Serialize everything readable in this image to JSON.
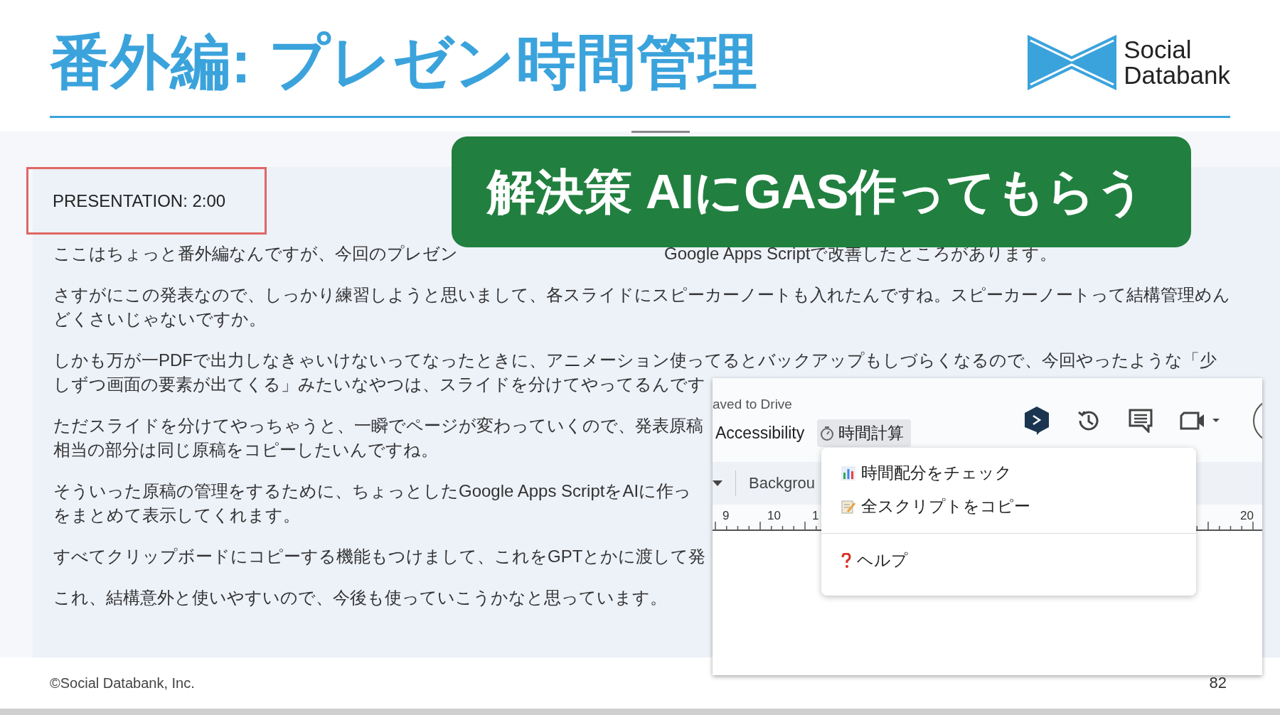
{
  "slide": {
    "title": "番外編: プレゼン時間管理",
    "logo_lines": [
      "Social",
      "Databank"
    ],
    "copyright": "©Social Databank, Inc.",
    "page_number": "82"
  },
  "notes": {
    "heading": "PRESENTATION: 2:00",
    "paragraphs": [
      {
        "lines": [
          [
            "ここはちょっと番外編なんですが、今回のプレゼン",
            "Google Apps Scriptで改善したところがあります。"
          ]
        ]
      },
      {
        "lines": [
          [
            "さすがにこの発表なので、しっかり練習しようと思いまして、各スライドにスピーカーノートも入れたんですね。スピーカーノートって結構管理めん"
          ],
          [
            "どくさいじゃないですか。"
          ]
        ]
      },
      {
        "lines": [
          [
            "しかも万が一PDFで出力しなきゃいけないってなったときに、アニメーション使ってるとバックアップもしづらくなるので、今回やったような「少"
          ],
          [
            "しずつ画面の要素が出てくる」みたいなやつは、スライドを分けてやってるんです"
          ]
        ]
      },
      {
        "lines": [
          [
            "ただスライドを分けてやっちゃうと、一瞬でページが変わっていくので、発表原稿"
          ],
          [
            "相当の部分は同じ原稿をコピーしたいんですね。"
          ]
        ]
      },
      {
        "lines": [
          [
            "そういった原稿の管理をするために、ちょっとしたGoogle Apps ScriptをAIに作っ"
          ],
          [
            "をまとめて表示してくれます。"
          ]
        ]
      },
      {
        "lines": [
          [
            "すべてクリップボードにコピーする機能もつけまして、これをGPTとかに渡して発"
          ]
        ]
      },
      {
        "lines": [
          [
            "これ、結構意外と使いやすいので、今後も使っていこうかなと思っています。"
          ]
        ]
      }
    ]
  },
  "banner": "解決策 AIにGAS作ってもらう",
  "editor": {
    "save_status": "aved to Drive",
    "menus": [
      {
        "label": "Accessibility",
        "kind": "plain",
        "selected": false
      },
      {
        "label": "時間計算",
        "kind": "timer",
        "selected": true
      }
    ],
    "toolbar_label": "Backgrou",
    "ruler": [
      "9",
      "10",
      "1",
      "20"
    ],
    "dropdown": [
      {
        "kind": "chart",
        "label": "時間配分をチェック"
      },
      {
        "kind": "memo",
        "label": "全スクリプトをコピー"
      },
      {
        "kind": "divider"
      },
      {
        "kind": "help",
        "label": "ヘルプ"
      }
    ]
  }
}
